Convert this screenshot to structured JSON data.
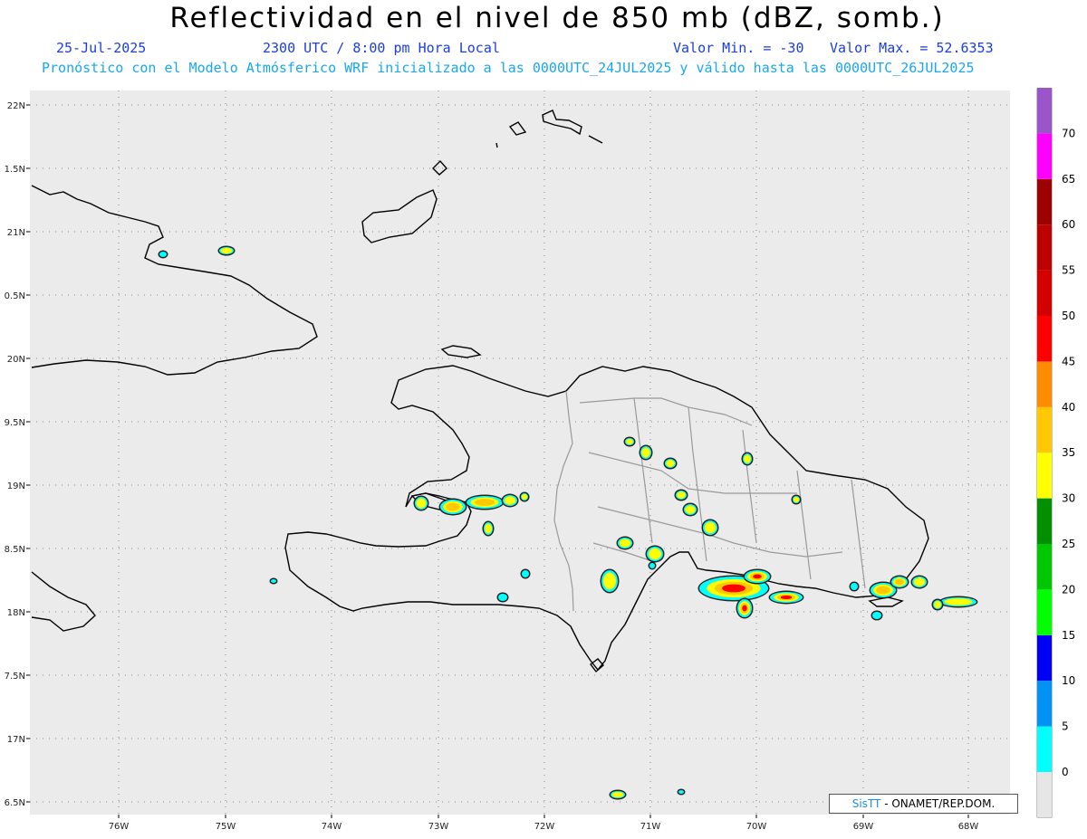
{
  "header": {
    "title": "Reflectividad en el nivel de 850 mb (dBZ, somb.)",
    "date": "25-Jul-2025",
    "time": "2300 UTC / 8:00 pm Hora Local",
    "min": "Valor Min. = -30",
    "max": "Valor Max. = 52.6353",
    "forecast": "Pronóstico con el Modelo Atmósferico WRF inicializado a las 0000UTC_24JUL2025 y válido hasta las  0000UTC_26JUL2025"
  },
  "lat_labels": [
    "22N",
    "1.5N",
    "21N",
    "0.5N",
    "20N",
    "9.5N",
    "19N",
    "8.5N",
    "18N",
    "7.5N",
    "17N",
    "6.5N"
  ],
  "lon_labels": [
    "76W",
    "75W",
    "74W",
    "73W",
    "72W",
    "71W",
    "70W",
    "69W",
    "68W"
  ],
  "colorbar": {
    "ticks": [
      "0",
      "5",
      "10",
      "15",
      "20",
      "25",
      "30",
      "35",
      "40",
      "45",
      "50",
      "55",
      "60",
      "65",
      "70"
    ],
    "colors": [
      "#00ffff",
      "#0093f5",
      "#0000f5",
      "#00ff00",
      "#00c800",
      "#009000",
      "#ffff00",
      "#ffc800",
      "#ff8c00",
      "#ff0000",
      "#d40000",
      "#bd0000",
      "#9c0000",
      "#ff00ff",
      "#9955c9"
    ]
  },
  "credit": {
    "logo": "SisTT",
    "text": "- ONAMET/REP.DOM."
  }
}
